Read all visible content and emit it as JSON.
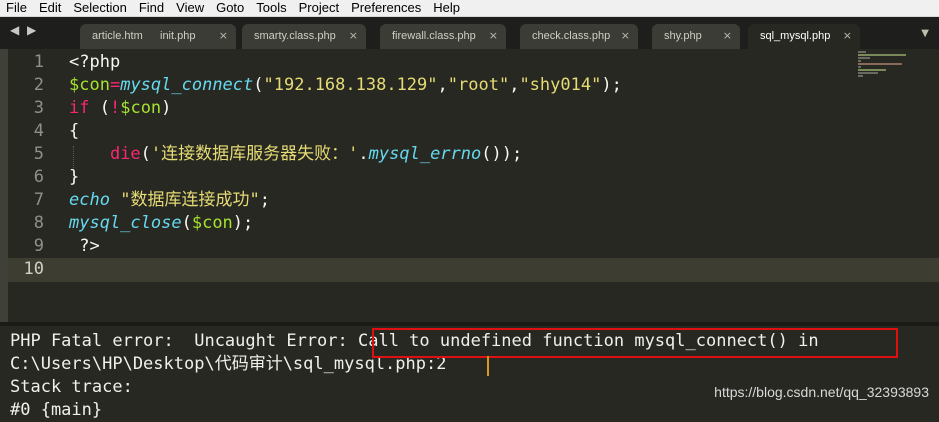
{
  "menu": [
    "File",
    "Edit",
    "Selection",
    "Find",
    "View",
    "Goto",
    "Tools",
    "Project",
    "Preferences",
    "Help"
  ],
  "nav_arrows": "◀ ▶",
  "tabs": [
    {
      "label": "article.htm",
      "active": false
    },
    {
      "label": "init.php",
      "active": false
    },
    {
      "label": "smarty.class.php",
      "active": false
    },
    {
      "label": "firewall.class.php",
      "active": false
    },
    {
      "label": "check.class.php",
      "active": false
    },
    {
      "label": "shy.php",
      "active": false
    },
    {
      "label": "sql_mysql.php",
      "active": true
    }
  ],
  "tab_close": "×",
  "tab_dropdown": "▼",
  "line_numbers": [
    "1",
    "2",
    "3",
    "4",
    "5",
    "6",
    "7",
    "8",
    "9",
    "10"
  ],
  "current_line": "10",
  "code": {
    "l1": "<?php",
    "l2_var": "$con",
    "l2_op": "=",
    "l2_fn": "mysql_connect",
    "l2_open": "(",
    "l2_s1": "\"192.168.138.129\"",
    "l2_c1": ",",
    "l2_s2": "\"root\"",
    "l2_c2": ",",
    "l2_s3": "\"shy014\"",
    "l2_close": ");",
    "l3_kw": "if",
    "l3_a": " (",
    "l3_not": "!",
    "l3_var": "$con",
    "l3_b": ")",
    "l4": "{",
    "l5_indent": "    ",
    "l5_fn": "die",
    "l5_open": "(",
    "l5_str": "'连接数据库服务器失败：'",
    "l5_dot": ".",
    "l5_fn2": "mysql_errno",
    "l5_close": "());",
    "l6": "}",
    "l7_kw": "echo",
    "l7_sp": " ",
    "l7_str": "\"数据库连接成功\"",
    "l7_end": ";",
    "l8_fn": "mysql_close",
    "l8_open": "(",
    "l8_var": "$con",
    "l8_close": ");",
    "l9": " ?>"
  },
  "console": {
    "line1_prefix": "PHP Fatal error:  Uncaught Error: ",
    "line1_highlight": "Call to undefined function mysql_connect() in",
    "line2": "C:\\Users\\HP\\Desktop\\代码审计\\sql_mysql.php:2",
    "line3": "Stack trace:",
    "line4": "#0 {main}"
  },
  "watermark": "https://blog.csdn.net/qq_32393893",
  "colors": {
    "editor_bg": "#272822",
    "keyword": "#f92672",
    "variable": "#a6e22e",
    "function": "#66d9ef",
    "string": "#e6db74",
    "highlight_box": "#e01010"
  }
}
